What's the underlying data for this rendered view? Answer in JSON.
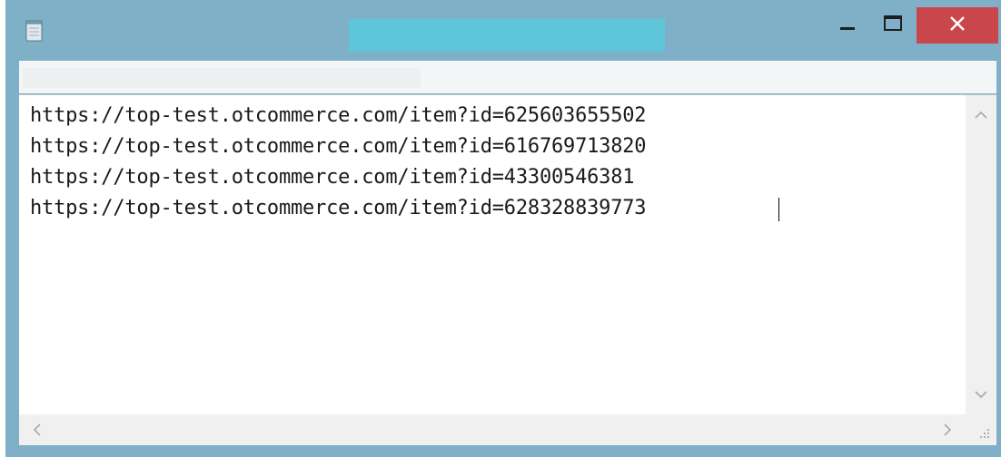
{
  "window": {
    "controls": {
      "minimize_icon": "minimize-icon",
      "maximize_icon": "maximize-icon",
      "close_icon": "close-icon"
    }
  },
  "editor": {
    "lines": [
      "https://top-test.otcommerce.com/item?id=625603655502",
      "https://top-test.otcommerce.com/item?id=616769713820",
      "https://top-test.otcommerce.com/item?id=43300546381",
      "https://top-test.otcommerce.com/item?id=628328839773"
    ]
  },
  "colors": {
    "frame": "#7fb0c8",
    "close_button": "#c9474a",
    "title_redaction": "#5ec6d8",
    "text": "#1a1a1a"
  }
}
